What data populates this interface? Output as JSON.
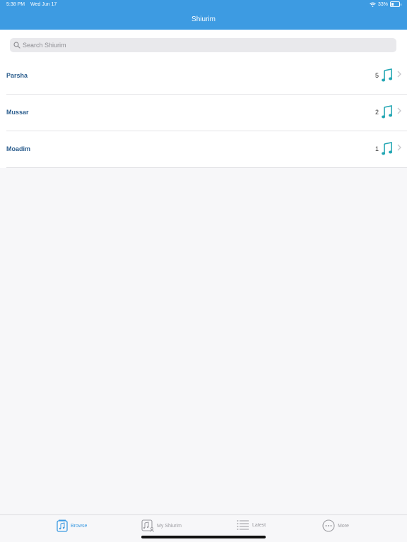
{
  "status_bar": {
    "time": "5:38 PM",
    "date": "Wed Jun 17",
    "battery": "33%"
  },
  "header": {
    "title": "Shiurim"
  },
  "search": {
    "placeholder": "Search Shiurim"
  },
  "categories": [
    {
      "label": "Parsha",
      "count": "5"
    },
    {
      "label": "Mussar",
      "count": "2"
    },
    {
      "label": "Moadim",
      "count": "1"
    }
  ],
  "tabs": [
    {
      "label": "Browse",
      "icon": "music-folder-icon",
      "active": true
    },
    {
      "label": "My Shiurim",
      "icon": "my-shiurim-icon",
      "active": false
    },
    {
      "label": "Latest",
      "icon": "list-icon",
      "active": false
    },
    {
      "label": "More",
      "icon": "ellipsis-circle-icon",
      "active": false
    }
  ],
  "colors": {
    "accent": "#3d9be2",
    "category_text": "#2c5e8e",
    "note_icon": "#22a6b3"
  }
}
